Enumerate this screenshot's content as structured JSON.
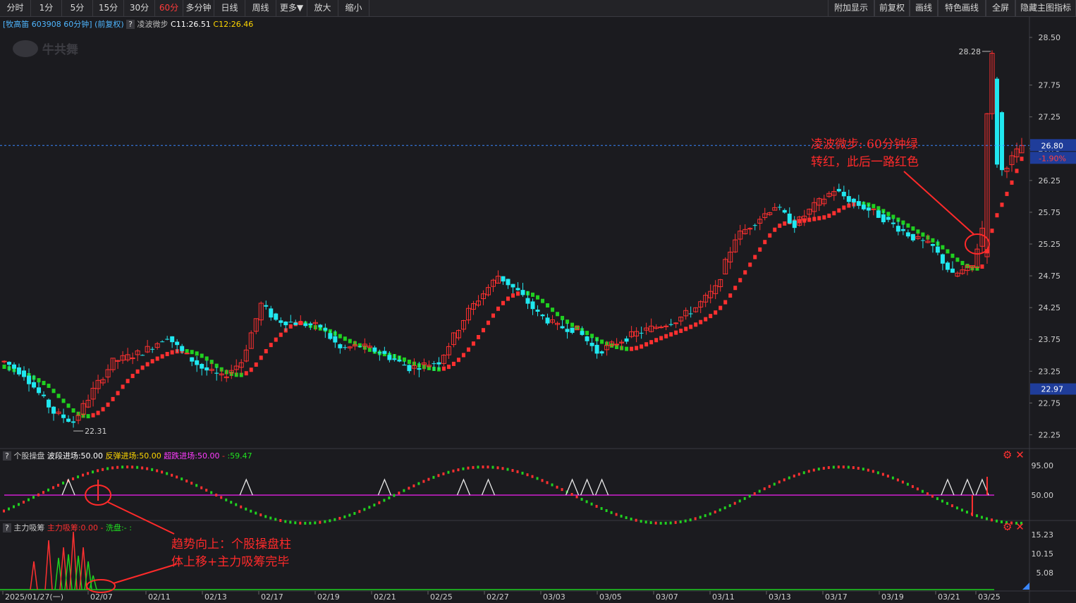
{
  "toolbar": {
    "left": [
      "分时",
      "1分",
      "5分",
      "15分",
      "30分",
      "60分",
      "多分钟",
      "日线",
      "周线",
      "更多▼",
      "放大",
      "缩小"
    ],
    "active": "60分",
    "right": [
      "附加显示",
      "前复权",
      "画线",
      "特色画线",
      "全屏",
      "隐藏主图指标"
    ]
  },
  "main_title": {
    "stock": "[牧高笛 603908 60分钟]",
    "adjust": "(前复权)",
    "help": "?",
    "indicator": "凌波微步",
    "c1": "C11:26.51",
    "c2": "C12:26.46"
  },
  "logo_text": "牛共舞",
  "price_labels": {
    "current": "26.80",
    "change": "-1.90%",
    "last_low_line": "22.97",
    "max": "28.28",
    "min": "22.31"
  },
  "annotation_main": [
    "凌波微步: 60分钟绿",
    "转红，此后一路红色"
  ],
  "annotation_sub": [
    "趋势向上：个股操盘柱",
    "体上移+主力吸筹完毕"
  ],
  "sub1": {
    "help": "?",
    "name": "个股操盘",
    "s1": "波段进场:50.00",
    "s2": "反弹进场:50.00",
    "s3": "超跌进场:50.00",
    "s4": "-",
    "s5": ":59.47",
    "ticks": [
      "95.00",
      "50.00"
    ]
  },
  "sub2": {
    "help": "?",
    "name": "主力吸筹",
    "s1": "主力吸筹:0.00",
    "s2": "-",
    "s3": "洗盘:-",
    "s4": ":",
    "ticks": [
      "15.23",
      "10.15",
      "5.08"
    ]
  },
  "colors": {
    "up": "#ff3030",
    "down": "#20e8f0",
    "green": "#20d020",
    "bg": "#1b1b1f",
    "grid": "#2e2e34"
  },
  "chart_data": {
    "type": "candlestick",
    "y_ticks": [
      "28.50",
      "27.75",
      "27.25",
      "26.75",
      "26.25",
      "25.75",
      "25.25",
      "24.75",
      "24.25",
      "23.75",
      "23.25",
      "22.75",
      "22.25"
    ],
    "x_labels": [
      "2025/01/27(一)",
      "02/07",
      "02/11",
      "02/13",
      "02/17",
      "02/19",
      "02/21",
      "02/25",
      "02/27",
      "03/03",
      "03/05",
      "03/07",
      "03/11",
      "03/13",
      "03/17",
      "03/19",
      "03/21",
      "03/25"
    ],
    "ylim": [
      22.1,
      28.6
    ],
    "anchors": [
      [
        0,
        23.4
      ],
      [
        4,
        23.2
      ],
      [
        10,
        22.6
      ],
      [
        14,
        22.45
      ],
      [
        18,
        22.95
      ],
      [
        22,
        23.4
      ],
      [
        28,
        23.55
      ],
      [
        33,
        23.8
      ],
      [
        36,
        23.55
      ],
      [
        40,
        23.3
      ],
      [
        44,
        23.15
      ],
      [
        48,
        23.4
      ],
      [
        52,
        24.3
      ],
      [
        55,
        24.05
      ],
      [
        60,
        24.0
      ],
      [
        64,
        23.95
      ],
      [
        68,
        23.6
      ],
      [
        72,
        23.65
      ],
      [
        76,
        23.55
      ],
      [
        82,
        23.3
      ],
      [
        88,
        23.4
      ],
      [
        94,
        24.2
      ],
      [
        100,
        24.75
      ],
      [
        104,
        24.5
      ],
      [
        108,
        24.15
      ],
      [
        112,
        23.95
      ],
      [
        116,
        23.9
      ],
      [
        120,
        23.55
      ],
      [
        124,
        23.7
      ],
      [
        128,
        23.85
      ],
      [
        132,
        23.95
      ],
      [
        136,
        24.05
      ],
      [
        140,
        24.25
      ],
      [
        144,
        24.55
      ],
      [
        148,
        25.35
      ],
      [
        152,
        25.6
      ],
      [
        156,
        25.85
      ],
      [
        160,
        25.55
      ],
      [
        164,
        25.85
      ],
      [
        168,
        26.1
      ],
      [
        172,
        25.9
      ],
      [
        176,
        25.75
      ],
      [
        180,
        25.55
      ],
      [
        184,
        25.35
      ],
      [
        188,
        25.2
      ],
      [
        192,
        24.75
      ],
      [
        196,
        24.9
      ],
      [
        198,
        25.5
      ],
      [
        199,
        27.5
      ],
      [
        200,
        28.2
      ],
      [
        202,
        26.4
      ],
      [
        206,
        26.8
      ]
    ],
    "n": 207,
    "max_label": "28.28",
    "min_label": "22.31",
    "last": 26.8
  }
}
